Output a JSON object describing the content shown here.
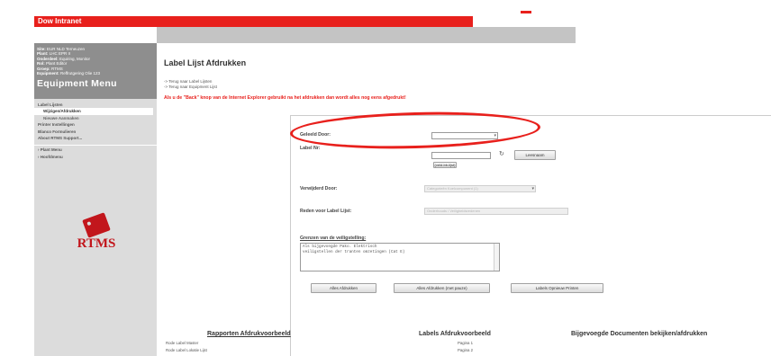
{
  "app": {
    "brand": "Dow Intranet"
  },
  "sidebar": {
    "info": [
      {
        "key": "Site:",
        "value": "EUR NLD Terneuzen"
      },
      {
        "key": "Plant:",
        "value": "LHC EPR II"
      },
      {
        "key": "Onderdeel:",
        "value": "Equiring, Monitor"
      },
      {
        "key": "Rol:",
        "value": "Plant Editor"
      },
      {
        "key": "Groep:",
        "value": "RTMS"
      },
      {
        "key": "Equipment:",
        "value": "Reffrutgering Olie 123"
      }
    ],
    "menu_title": "Equipment Menu",
    "menu": [
      {
        "label": "Label Lijsten",
        "level": 0,
        "active": false
      },
      {
        "label": "Wijzigen/Afdrukken",
        "level": 1,
        "active": true
      },
      {
        "label": "Nieuwe Aanmaken",
        "level": 1,
        "active": false
      },
      {
        "label": "Printer Instellingen",
        "level": 0,
        "active": false
      },
      {
        "label": "Blanco Formulieren",
        "level": 0,
        "active": false
      },
      {
        "label": "About RTMS Support...",
        "level": 0,
        "active": false
      }
    ],
    "bottom_menu": [
      {
        "label": "› Plant Menu"
      },
      {
        "label": "› Hoofdmenu"
      }
    ],
    "logo_text": "RTMS"
  },
  "main": {
    "title": "Label Lijst Afdrukken",
    "links": [
      "-> Terug naar Label Lijsten",
      "-> Terug naar Equipment Lijst"
    ],
    "warning": "Als u de \"Back\" knop van de Internet Explorer gebruikt na het afdrukken dan wordt alles nog eens afgedrukt!",
    "form": {
      "gebeld_door_label": "Geleeld Door:",
      "gebeld_door_value": "",
      "label_nr_label": "Label Nr:",
      "label_nr_value": "",
      "refresh_icon": "↻",
      "lees_button": "Leesnaam",
      "veld_btn": "(veld-bb-lijst)",
      "verwijderd_label": "Verwijderd Door:",
      "verwijderd_value": "Categorieën Koelcomponent (1)",
      "reden_label": "Reden voor Label Lijst:",
      "reden_value": "Onderhouds / Veiligheidsredenen",
      "grenzen_label": "Grenzen van de veiligstelling:",
      "grenzen_text": [
        "Als bijgevoegde Pako. Elektrisch",
        "veiligstellen der tranten omzetingen (Cat E)"
      ],
      "buttons": [
        "Alles Afdrukken",
        "Alles Afdrukken (met pauze)",
        "Labels Opnieuw Printen"
      ]
    },
    "columns": [
      {
        "title": "Rapporten Afdrukvoorbeeld",
        "items": [
          "Rode Label Master",
          "Rode Label Lokatie Lijst"
        ]
      },
      {
        "title": "Labels Afdrukvoorbeeld",
        "items": [
          "Pagina 1",
          "Pagina 2"
        ]
      },
      {
        "title": "Bijgevoegde Documenten bekijken/afdrukken",
        "items": []
      }
    ]
  },
  "colors": {
    "brand_red": "#e8201c",
    "sidebar_gray": "#8e8e8e",
    "logo_red": "#c2161c"
  }
}
